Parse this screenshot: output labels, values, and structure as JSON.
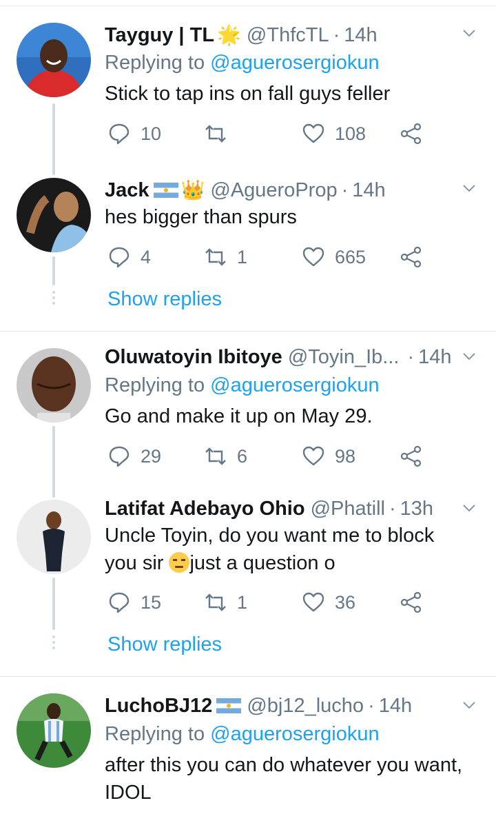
{
  "tweets": [
    {
      "name": "Tayguy | TL",
      "name_emoji": "🌟",
      "handle": "@ThfcTL",
      "time": "14h",
      "replying_prefix": "Replying to ",
      "replying_to": "@aguerosergiokun",
      "text": "Stick to tap ins on fall guys feller",
      "replies": "10",
      "retweets": "",
      "likes": "108"
    },
    {
      "name": "Jack",
      "name_emoji": "👑",
      "handle": "@AgueroProp",
      "time": "14h",
      "text": "hes bigger than spurs",
      "replies": "4",
      "retweets": "1",
      "likes": "665",
      "show_replies": "Show replies"
    },
    {
      "name": "Oluwatoyin Ibitoye",
      "handle": "@Toyin_Ib...",
      "time": "14h",
      "replying_prefix": "Replying to ",
      "replying_to": "@aguerosergiokun",
      "text": "Go and make it up on May 29.",
      "replies": "29",
      "retweets": "6",
      "likes": "98"
    },
    {
      "name": "Latifat Adebayo Ohio",
      "handle": "@Phatill",
      "time": "13h",
      "text_line1": "Uncle Toyin, do you want me to block",
      "text_line2a": "you sir ",
      "text_line2b": "just a question o",
      "replies": "15",
      "retweets": "1",
      "likes": "36",
      "show_replies": "Show replies"
    },
    {
      "name": "LuchoBJ12",
      "handle": "@bj12_lucho",
      "time": "14h",
      "replying_prefix": "Replying to ",
      "replying_to": "@aguerosergiokun",
      "text_line1": "after this you can do whatever you want,",
      "text_line2": "IDOL"
    }
  ],
  "separator": "·",
  "colors": {
    "link": "#1da1f2",
    "secondary": "#657786",
    "text": "#14171a",
    "divider": "#e1e8ed"
  }
}
